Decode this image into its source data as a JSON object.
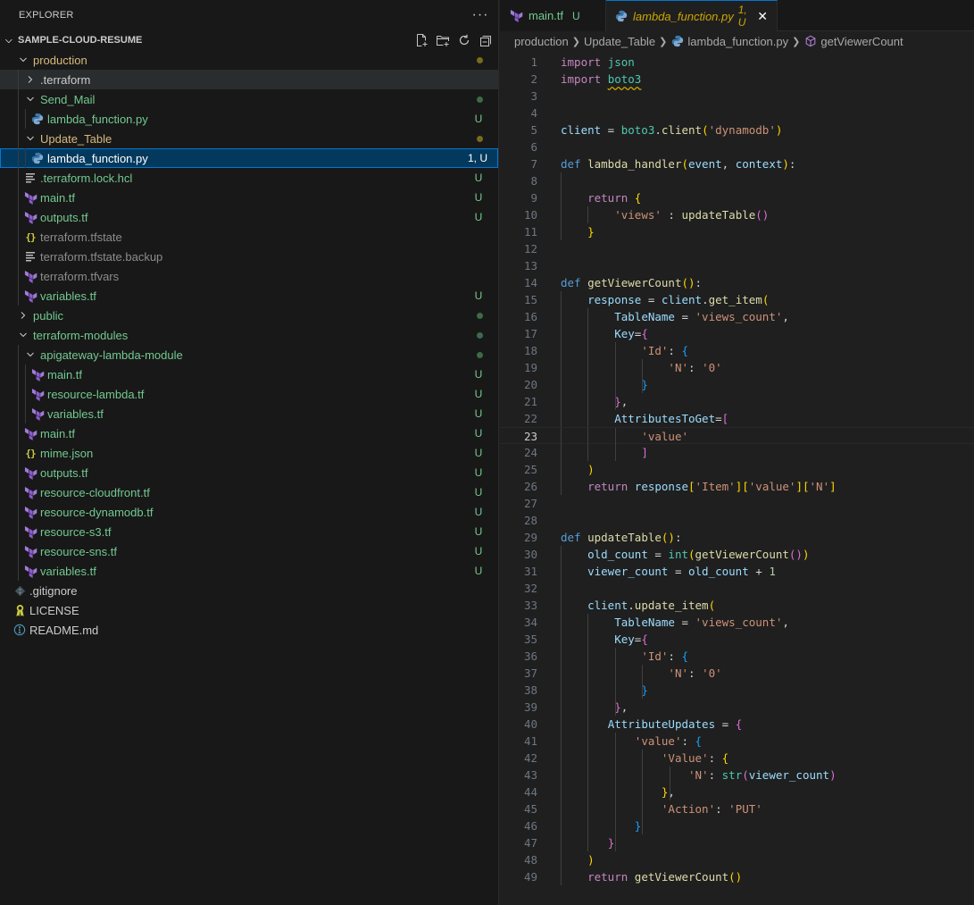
{
  "explorer": {
    "title": "EXPLORER",
    "more_label": "···",
    "root": "SAMPLE-CLOUD-RESUME",
    "actions": [
      "new-file",
      "new-folder",
      "refresh",
      "collapse-all"
    ],
    "items": [
      {
        "name": "production",
        "type": "folder",
        "expanded": true,
        "depth": 0,
        "color": "yellow",
        "status": "dot-yellow"
      },
      {
        "name": ".terraform",
        "type": "folder",
        "expanded": false,
        "depth": 1,
        "color": "white",
        "status": ""
      },
      {
        "name": "Send_Mail",
        "type": "folder",
        "expanded": true,
        "depth": 1,
        "color": "green",
        "status": "dot-green"
      },
      {
        "name": "lambda_function.py",
        "type": "python",
        "depth": 2,
        "color": "green",
        "status": "U"
      },
      {
        "name": "Update_Table",
        "type": "folder",
        "expanded": true,
        "depth": 1,
        "color": "yellow",
        "status": "dot-yellow"
      },
      {
        "name": "lambda_function.py",
        "type": "python",
        "depth": 2,
        "color": "yellow",
        "status": "1, U",
        "selected": true
      },
      {
        "name": ".terraform.lock.hcl",
        "type": "lines",
        "depth": 1,
        "color": "green",
        "status": "U"
      },
      {
        "name": "main.tf",
        "type": "terraform",
        "depth": 1,
        "color": "green",
        "status": "U"
      },
      {
        "name": "outputs.tf",
        "type": "terraform",
        "depth": 1,
        "color": "green",
        "status": "U"
      },
      {
        "name": "terraform.tfstate",
        "type": "json",
        "depth": 1,
        "color": "grey",
        "status": ""
      },
      {
        "name": "terraform.tfstate.backup",
        "type": "lines",
        "depth": 1,
        "color": "grey",
        "status": ""
      },
      {
        "name": "terraform.tfvars",
        "type": "terraform",
        "depth": 1,
        "color": "grey",
        "status": ""
      },
      {
        "name": "variables.tf",
        "type": "terraform",
        "depth": 1,
        "color": "green",
        "status": "U"
      },
      {
        "name": "public",
        "type": "folder",
        "expanded": false,
        "depth": 0,
        "color": "green",
        "status": "dot-green"
      },
      {
        "name": "terraform-modules",
        "type": "folder",
        "expanded": true,
        "depth": 0,
        "color": "green",
        "status": "dot-green"
      },
      {
        "name": "apigateway-lambda-module",
        "type": "folder",
        "expanded": true,
        "depth": 1,
        "color": "green",
        "status": "dot-green"
      },
      {
        "name": "main.tf",
        "type": "terraform",
        "depth": 2,
        "color": "green",
        "status": "U"
      },
      {
        "name": "resource-lambda.tf",
        "type": "terraform",
        "depth": 2,
        "color": "green",
        "status": "U"
      },
      {
        "name": "variables.tf",
        "type": "terraform",
        "depth": 2,
        "color": "green",
        "status": "U"
      },
      {
        "name": "main.tf",
        "type": "terraform",
        "depth": 1,
        "color": "green",
        "status": "U"
      },
      {
        "name": "mime.json",
        "type": "json",
        "depth": 1,
        "color": "green",
        "status": "U"
      },
      {
        "name": "outputs.tf",
        "type": "terraform",
        "depth": 1,
        "color": "green",
        "status": "U"
      },
      {
        "name": "resource-cloudfront.tf",
        "type": "terraform",
        "depth": 1,
        "color": "green",
        "status": "U"
      },
      {
        "name": "resource-dynamodb.tf",
        "type": "terraform",
        "depth": 1,
        "color": "green",
        "status": "U"
      },
      {
        "name": "resource-s3.tf",
        "type": "terraform",
        "depth": 1,
        "color": "green",
        "status": "U"
      },
      {
        "name": "resource-sns.tf",
        "type": "terraform",
        "depth": 1,
        "color": "green",
        "status": "U"
      },
      {
        "name": "variables.tf",
        "type": "terraform",
        "depth": 1,
        "color": "green",
        "status": "U"
      },
      {
        "name": ".gitignore",
        "type": "git",
        "depth": 0,
        "color": "white",
        "status": ""
      },
      {
        "name": "LICENSE",
        "type": "license",
        "depth": 0,
        "color": "white",
        "status": ""
      },
      {
        "name": "README.md",
        "type": "info",
        "depth": 0,
        "color": "white",
        "status": ""
      }
    ]
  },
  "tabs": [
    {
      "name": "main.tf",
      "badge": "U",
      "icon": "terraform",
      "active": false
    },
    {
      "name": "lambda_function.py",
      "badge": "1, U",
      "icon": "python",
      "active": true
    }
  ],
  "breadcrumb": {
    "parts": [
      "production",
      "Update_Table",
      "lambda_function.py",
      "getViewerCount"
    ]
  },
  "editor": {
    "current_line": 23,
    "lines": [
      [
        [
          "kw",
          "import"
        ],
        [
          "op",
          " "
        ],
        [
          "mod",
          "json"
        ]
      ],
      [
        [
          "kw",
          "import"
        ],
        [
          "op",
          " "
        ],
        [
          "mod squig",
          "boto3"
        ]
      ],
      [],
      [],
      [
        [
          "var",
          "client"
        ],
        [
          "op",
          " = "
        ],
        [
          "mod",
          "boto3"
        ],
        [
          "op",
          "."
        ],
        [
          "fn",
          "client"
        ],
        [
          "b1",
          "("
        ],
        [
          "str",
          "'dynamodb'"
        ],
        [
          "b1",
          ")"
        ]
      ],
      [],
      [
        [
          "kb",
          "def"
        ],
        [
          "op",
          " "
        ],
        [
          "fn",
          "lambda_handler"
        ],
        [
          "b1",
          "("
        ],
        [
          "var",
          "event"
        ],
        [
          "op",
          ", "
        ],
        [
          "var",
          "context"
        ],
        [
          "b1",
          ")"
        ],
        [
          "op",
          ":"
        ]
      ],
      [],
      [
        [
          "op",
          "    "
        ],
        [
          "kw",
          "return"
        ],
        [
          "op",
          " "
        ],
        [
          "b1",
          "{"
        ]
      ],
      [
        [
          "op",
          "        "
        ],
        [
          "str",
          "'views'"
        ],
        [
          "op",
          " : "
        ],
        [
          "fn",
          "updateTable"
        ],
        [
          "b2",
          "()"
        ]
      ],
      [
        [
          "op",
          "    "
        ],
        [
          "b1",
          "}"
        ]
      ],
      [],
      [],
      [
        [
          "kb",
          "def"
        ],
        [
          "op",
          " "
        ],
        [
          "fn",
          "getViewerCount"
        ],
        [
          "b1",
          "()"
        ],
        [
          "op",
          ":"
        ]
      ],
      [
        [
          "op",
          "    "
        ],
        [
          "var",
          "response"
        ],
        [
          "op",
          " = "
        ],
        [
          "var",
          "client"
        ],
        [
          "op",
          "."
        ],
        [
          "fn",
          "get_item"
        ],
        [
          "b1",
          "("
        ]
      ],
      [
        [
          "op",
          "        "
        ],
        [
          "var",
          "TableName"
        ],
        [
          "op",
          " = "
        ],
        [
          "str",
          "'views_count'"
        ],
        [
          "op",
          ","
        ]
      ],
      [
        [
          "op",
          "        "
        ],
        [
          "var",
          "Key"
        ],
        [
          "op",
          "="
        ],
        [
          "b2",
          "{"
        ]
      ],
      [
        [
          "op",
          "            "
        ],
        [
          "str",
          "'Id'"
        ],
        [
          "op",
          ": "
        ],
        [
          "b3",
          "{"
        ]
      ],
      [
        [
          "op",
          "                "
        ],
        [
          "str",
          "'N'"
        ],
        [
          "op",
          ": "
        ],
        [
          "str",
          "'0'"
        ]
      ],
      [
        [
          "op",
          "            "
        ],
        [
          "b3",
          "}"
        ]
      ],
      [
        [
          "op",
          "        "
        ],
        [
          "b2",
          "}"
        ],
        [
          "op",
          ","
        ]
      ],
      [
        [
          "op",
          "        "
        ],
        [
          "var",
          "AttributesToGet"
        ],
        [
          "op",
          "="
        ],
        [
          "b2",
          "["
        ]
      ],
      [
        [
          "op",
          "            "
        ],
        [
          "str",
          "'value'"
        ]
      ],
      [
        [
          "op",
          "            "
        ],
        [
          "b2",
          "]"
        ]
      ],
      [
        [
          "op",
          "    "
        ],
        [
          "b1",
          ")"
        ]
      ],
      [
        [
          "op",
          "    "
        ],
        [
          "kw",
          "return"
        ],
        [
          "op",
          " "
        ],
        [
          "var",
          "response"
        ],
        [
          "b1",
          "["
        ],
        [
          "str",
          "'Item'"
        ],
        [
          "b1",
          "]["
        ],
        [
          "str",
          "'value'"
        ],
        [
          "b1",
          "]["
        ],
        [
          "str",
          "'N'"
        ],
        [
          "b1",
          "]"
        ]
      ],
      [],
      [],
      [
        [
          "kb",
          "def"
        ],
        [
          "op",
          " "
        ],
        [
          "fn",
          "updateTable"
        ],
        [
          "b1",
          "()"
        ],
        [
          "op",
          ":"
        ]
      ],
      [
        [
          "op",
          "    "
        ],
        [
          "var",
          "old_count"
        ],
        [
          "op",
          " = "
        ],
        [
          "mod",
          "int"
        ],
        [
          "b1",
          "("
        ],
        [
          "fn",
          "getViewerCount"
        ],
        [
          "b2",
          "()"
        ],
        [
          "b1",
          ")"
        ]
      ],
      [
        [
          "op",
          "    "
        ],
        [
          "var",
          "viewer_count"
        ],
        [
          "op",
          " = "
        ],
        [
          "var",
          "old_count"
        ],
        [
          "op",
          " + "
        ],
        [
          "num",
          "1"
        ]
      ],
      [],
      [
        [
          "op",
          "    "
        ],
        [
          "var",
          "client"
        ],
        [
          "op",
          "."
        ],
        [
          "fn",
          "update_item"
        ],
        [
          "b1",
          "("
        ]
      ],
      [
        [
          "op",
          "        "
        ],
        [
          "var",
          "TableName"
        ],
        [
          "op",
          " = "
        ],
        [
          "str",
          "'views_count'"
        ],
        [
          "op",
          ","
        ]
      ],
      [
        [
          "op",
          "        "
        ],
        [
          "var",
          "Key"
        ],
        [
          "op",
          "="
        ],
        [
          "b2",
          "{"
        ]
      ],
      [
        [
          "op",
          "            "
        ],
        [
          "str",
          "'Id'"
        ],
        [
          "op",
          ": "
        ],
        [
          "b3",
          "{"
        ]
      ],
      [
        [
          "op",
          "                "
        ],
        [
          "str",
          "'N'"
        ],
        [
          "op",
          ": "
        ],
        [
          "str",
          "'0'"
        ]
      ],
      [
        [
          "op",
          "            "
        ],
        [
          "b3",
          "}"
        ]
      ],
      [
        [
          "op",
          "        "
        ],
        [
          "b2",
          "}"
        ],
        [
          "op",
          ","
        ]
      ],
      [
        [
          "op",
          "       "
        ],
        [
          "var",
          "AttributeUpdates"
        ],
        [
          "op",
          " = "
        ],
        [
          "b2",
          "{"
        ]
      ],
      [
        [
          "op",
          "           "
        ],
        [
          "str",
          "'value'"
        ],
        [
          "op",
          ": "
        ],
        [
          "b3",
          "{"
        ]
      ],
      [
        [
          "op",
          "               "
        ],
        [
          "str",
          "'Value'"
        ],
        [
          "op",
          ": "
        ],
        [
          "b1",
          "{"
        ]
      ],
      [
        [
          "op",
          "                   "
        ],
        [
          "str",
          "'N'"
        ],
        [
          "op",
          ": "
        ],
        [
          "mod",
          "str"
        ],
        [
          "b2",
          "("
        ],
        [
          "var",
          "viewer_count"
        ],
        [
          "b2",
          ")"
        ]
      ],
      [
        [
          "op",
          "               "
        ],
        [
          "b1",
          "}"
        ],
        [
          "op",
          ","
        ]
      ],
      [
        [
          "op",
          "               "
        ],
        [
          "str",
          "'Action'"
        ],
        [
          "op",
          ": "
        ],
        [
          "str",
          "'PUT'"
        ]
      ],
      [
        [
          "op",
          "           "
        ],
        [
          "b3",
          "}"
        ]
      ],
      [
        [
          "op",
          "       "
        ],
        [
          "b2",
          "}"
        ]
      ],
      [
        [
          "op",
          "    "
        ],
        [
          "b1",
          ")"
        ]
      ],
      [
        [
          "op",
          "    "
        ],
        [
          "kw",
          "return"
        ],
        [
          "op",
          " "
        ],
        [
          "fn",
          "getViewerCount"
        ],
        [
          "b1",
          "()"
        ]
      ]
    ]
  }
}
